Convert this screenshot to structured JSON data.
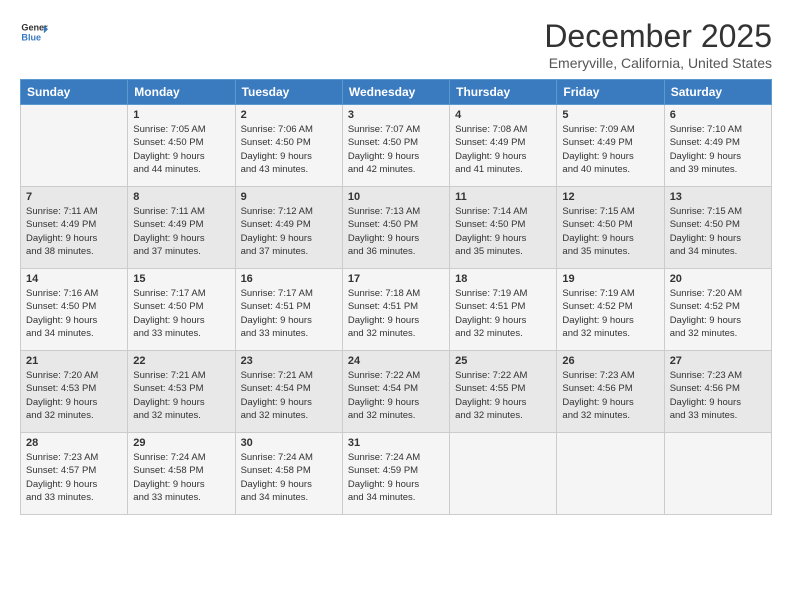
{
  "header": {
    "logo_line1": "General",
    "logo_line2": "Blue",
    "title": "December 2025",
    "subtitle": "Emeryville, California, United States"
  },
  "weekdays": [
    "Sunday",
    "Monday",
    "Tuesday",
    "Wednesday",
    "Thursday",
    "Friday",
    "Saturday"
  ],
  "weeks": [
    [
      {
        "day": "",
        "info": ""
      },
      {
        "day": "1",
        "info": "Sunrise: 7:05 AM\nSunset: 4:50 PM\nDaylight: 9 hours\nand 44 minutes."
      },
      {
        "day": "2",
        "info": "Sunrise: 7:06 AM\nSunset: 4:50 PM\nDaylight: 9 hours\nand 43 minutes."
      },
      {
        "day": "3",
        "info": "Sunrise: 7:07 AM\nSunset: 4:50 PM\nDaylight: 9 hours\nand 42 minutes."
      },
      {
        "day": "4",
        "info": "Sunrise: 7:08 AM\nSunset: 4:49 PM\nDaylight: 9 hours\nand 41 minutes."
      },
      {
        "day": "5",
        "info": "Sunrise: 7:09 AM\nSunset: 4:49 PM\nDaylight: 9 hours\nand 40 minutes."
      },
      {
        "day": "6",
        "info": "Sunrise: 7:10 AM\nSunset: 4:49 PM\nDaylight: 9 hours\nand 39 minutes."
      }
    ],
    [
      {
        "day": "7",
        "info": "Sunrise: 7:11 AM\nSunset: 4:49 PM\nDaylight: 9 hours\nand 38 minutes."
      },
      {
        "day": "8",
        "info": "Sunrise: 7:11 AM\nSunset: 4:49 PM\nDaylight: 9 hours\nand 37 minutes."
      },
      {
        "day": "9",
        "info": "Sunrise: 7:12 AM\nSunset: 4:49 PM\nDaylight: 9 hours\nand 37 minutes."
      },
      {
        "day": "10",
        "info": "Sunrise: 7:13 AM\nSunset: 4:50 PM\nDaylight: 9 hours\nand 36 minutes."
      },
      {
        "day": "11",
        "info": "Sunrise: 7:14 AM\nSunset: 4:50 PM\nDaylight: 9 hours\nand 35 minutes."
      },
      {
        "day": "12",
        "info": "Sunrise: 7:15 AM\nSunset: 4:50 PM\nDaylight: 9 hours\nand 35 minutes."
      },
      {
        "day": "13",
        "info": "Sunrise: 7:15 AM\nSunset: 4:50 PM\nDaylight: 9 hours\nand 34 minutes."
      }
    ],
    [
      {
        "day": "14",
        "info": "Sunrise: 7:16 AM\nSunset: 4:50 PM\nDaylight: 9 hours\nand 34 minutes."
      },
      {
        "day": "15",
        "info": "Sunrise: 7:17 AM\nSunset: 4:50 PM\nDaylight: 9 hours\nand 33 minutes."
      },
      {
        "day": "16",
        "info": "Sunrise: 7:17 AM\nSunset: 4:51 PM\nDaylight: 9 hours\nand 33 minutes."
      },
      {
        "day": "17",
        "info": "Sunrise: 7:18 AM\nSunset: 4:51 PM\nDaylight: 9 hours\nand 32 minutes."
      },
      {
        "day": "18",
        "info": "Sunrise: 7:19 AM\nSunset: 4:51 PM\nDaylight: 9 hours\nand 32 minutes."
      },
      {
        "day": "19",
        "info": "Sunrise: 7:19 AM\nSunset: 4:52 PM\nDaylight: 9 hours\nand 32 minutes."
      },
      {
        "day": "20",
        "info": "Sunrise: 7:20 AM\nSunset: 4:52 PM\nDaylight: 9 hours\nand 32 minutes."
      }
    ],
    [
      {
        "day": "21",
        "info": "Sunrise: 7:20 AM\nSunset: 4:53 PM\nDaylight: 9 hours\nand 32 minutes."
      },
      {
        "day": "22",
        "info": "Sunrise: 7:21 AM\nSunset: 4:53 PM\nDaylight: 9 hours\nand 32 minutes."
      },
      {
        "day": "23",
        "info": "Sunrise: 7:21 AM\nSunset: 4:54 PM\nDaylight: 9 hours\nand 32 minutes."
      },
      {
        "day": "24",
        "info": "Sunrise: 7:22 AM\nSunset: 4:54 PM\nDaylight: 9 hours\nand 32 minutes."
      },
      {
        "day": "25",
        "info": "Sunrise: 7:22 AM\nSunset: 4:55 PM\nDaylight: 9 hours\nand 32 minutes."
      },
      {
        "day": "26",
        "info": "Sunrise: 7:23 AM\nSunset: 4:56 PM\nDaylight: 9 hours\nand 32 minutes."
      },
      {
        "day": "27",
        "info": "Sunrise: 7:23 AM\nSunset: 4:56 PM\nDaylight: 9 hours\nand 33 minutes."
      }
    ],
    [
      {
        "day": "28",
        "info": "Sunrise: 7:23 AM\nSunset: 4:57 PM\nDaylight: 9 hours\nand 33 minutes."
      },
      {
        "day": "29",
        "info": "Sunrise: 7:24 AM\nSunset: 4:58 PM\nDaylight: 9 hours\nand 33 minutes."
      },
      {
        "day": "30",
        "info": "Sunrise: 7:24 AM\nSunset: 4:58 PM\nDaylight: 9 hours\nand 34 minutes."
      },
      {
        "day": "31",
        "info": "Sunrise: 7:24 AM\nSunset: 4:59 PM\nDaylight: 9 hours\nand 34 minutes."
      },
      {
        "day": "",
        "info": ""
      },
      {
        "day": "",
        "info": ""
      },
      {
        "day": "",
        "info": ""
      }
    ]
  ]
}
